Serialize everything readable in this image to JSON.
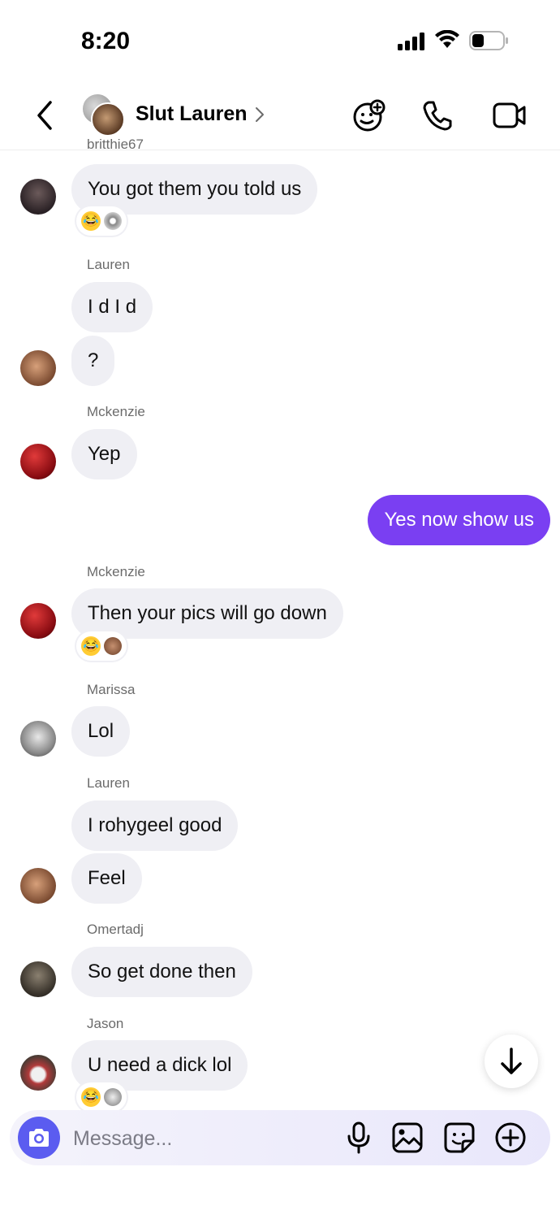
{
  "status_bar": {
    "time": "8:20"
  },
  "header": {
    "title": "Slut Lauren",
    "icons": [
      "back-icon",
      "add-game-icon",
      "phone-icon",
      "video-icon"
    ]
  },
  "cut_sender": "britthie67",
  "messages": [
    {
      "sender": "",
      "text": "You got them you told us",
      "reactions": [
        "laughing-emoji",
        "avatar"
      ]
    },
    {
      "sender": "Lauren",
      "texts": [
        "I d I d",
        "?"
      ]
    },
    {
      "sender": "Mckenzie",
      "text": "Yep"
    },
    {
      "sender": "me",
      "text": "Yes now show us"
    },
    {
      "sender": "Mckenzie",
      "text": "Then your pics will go down",
      "reactions": [
        "laughing-emoji",
        "avatar"
      ]
    },
    {
      "sender": "Marissa",
      "text": "Lol"
    },
    {
      "sender": "Lauren",
      "texts": [
        "I rohygeel good",
        "Feel"
      ]
    },
    {
      "sender": "Omertadj",
      "text": "So get done then"
    },
    {
      "sender": "Jason",
      "text": "U need a dick lol",
      "reactions": [
        "laughing-emoji",
        "avatar"
      ]
    }
  ],
  "composer": {
    "placeholder": "Message...",
    "icons": [
      "camera-icon",
      "microphone-icon",
      "gallery-icon",
      "sticker-icon",
      "plus-icon"
    ]
  },
  "colors": {
    "outgoing_bubble": "#7a3ff2",
    "incoming_bubble": "#efeff4",
    "camera_button": "#5b5cf0"
  }
}
